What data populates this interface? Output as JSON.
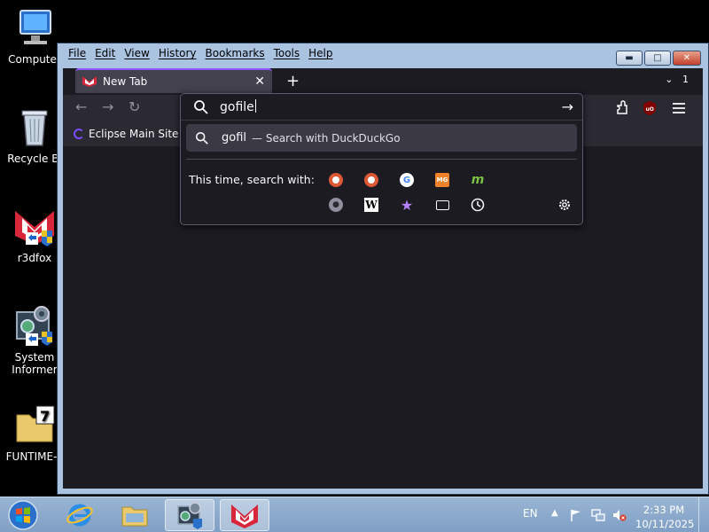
{
  "desktop": {
    "icons": [
      {
        "label": "Computer"
      },
      {
        "label": "Recycle Bi"
      },
      {
        "label": "r3dfox"
      },
      {
        "label": "System\nInformer"
      },
      {
        "label": "FUNTIME-F"
      }
    ]
  },
  "window": {
    "menu": [
      "File",
      "Edit",
      "View",
      "History",
      "Bookmarks",
      "Tools",
      "Help"
    ],
    "tab": {
      "title": "New Tab"
    },
    "tab_count": "1",
    "bookmark": {
      "label": "Eclipse Main Site"
    },
    "urlbar": {
      "value": "gofile",
      "suggestion_query": "gofil",
      "suggestion_desc": "— Search with DuckDuckGo",
      "engines_label": "This time, search with:"
    }
  },
  "taskbar": {
    "lang": "EN",
    "time": "2:33 PM",
    "date": "10/11/2025"
  },
  "colors": {
    "accent": "#9059ff",
    "toolbar": "#2b2a33",
    "content": "#1c1b22"
  }
}
